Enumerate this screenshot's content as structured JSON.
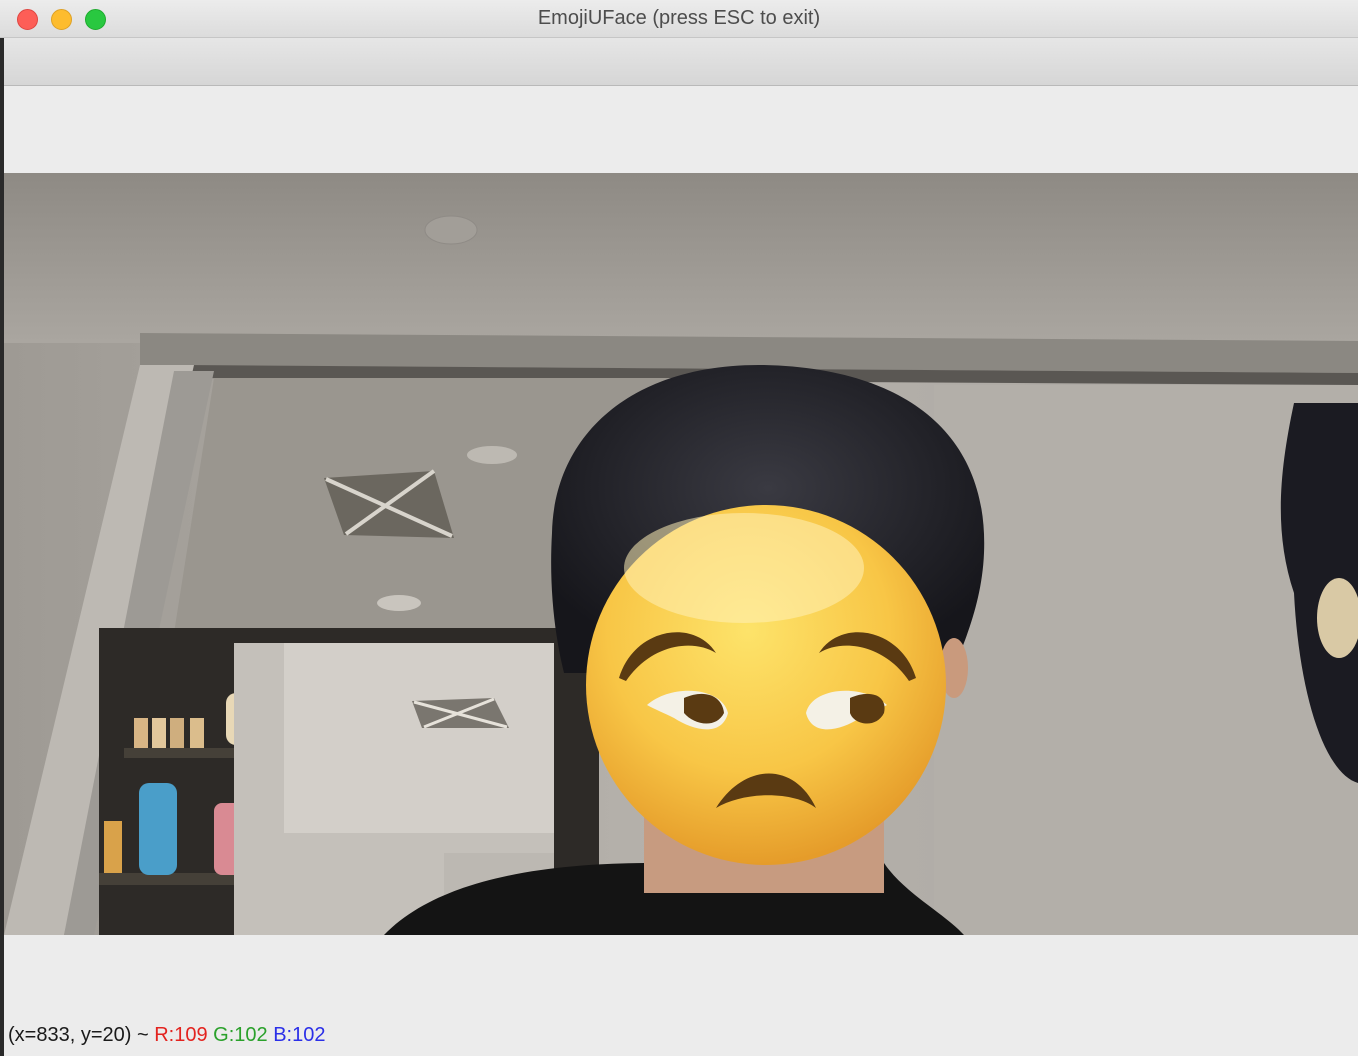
{
  "window": {
    "title": "EmojiUFace (press ESC to exit)"
  },
  "status": {
    "coords": "(x=833, y=20) ~ ",
    "r": "R:109",
    "g": "G:102",
    "b": "B:102"
  },
  "emoji": {
    "name": "unamused-face-icon"
  }
}
